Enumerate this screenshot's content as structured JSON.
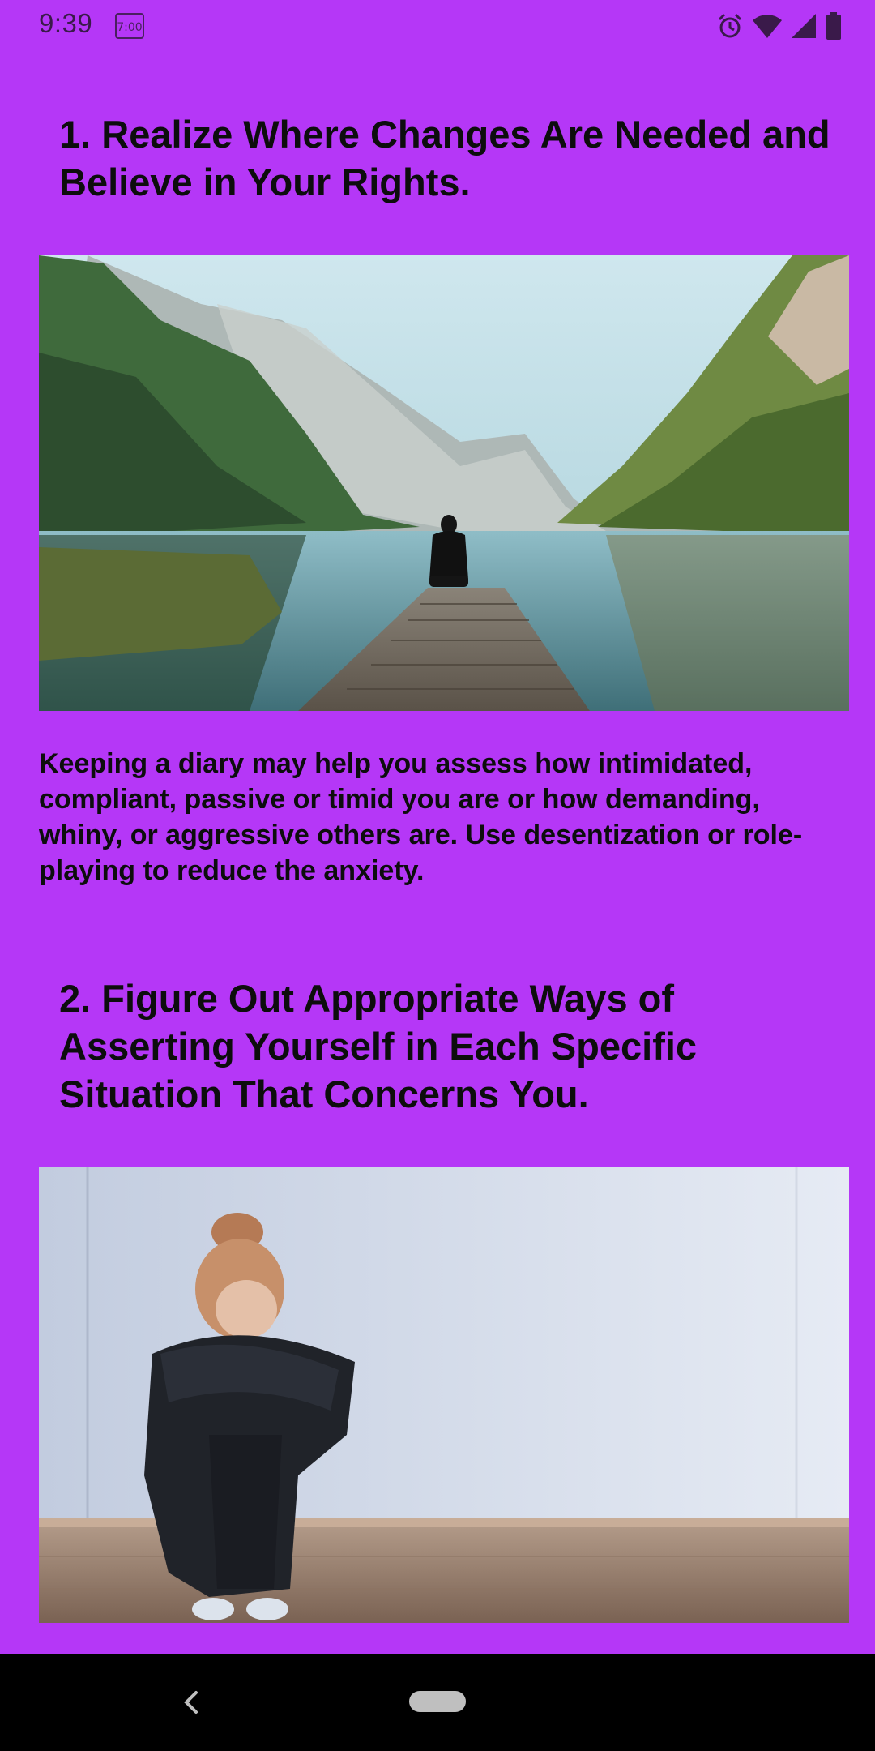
{
  "status_bar": {
    "time": "9:39",
    "notification_icon": "clock-notification-icon",
    "icons": [
      "alarm-icon",
      "wifi-icon",
      "signal-icon",
      "battery-icon"
    ]
  },
  "colors": {
    "background": "#b537f7",
    "text": "#0d0d0d",
    "nav_bar": "#000000"
  },
  "sections": [
    {
      "heading": "1.  Realize Where Changes Are Needed and Believe in Your Rights.",
      "image": "person-sitting-on-lake-dock-photo",
      "paragraph": "Keeping a diary may help you assess how intimidated, compliant, passive or timid you are or how demanding, whiny, or aggressive others are. Use desentization or role-playing to reduce the anxiety."
    },
    {
      "heading": "2.  Figure Out Appropriate Ways of Asserting Yourself in Each Specific Situation That Concerns You.",
      "image": "woman-sitting-against-wall-photo"
    }
  ],
  "nav_bar": {
    "back_icon": "back-chevron-icon",
    "home_icon": "home-pill-icon"
  }
}
